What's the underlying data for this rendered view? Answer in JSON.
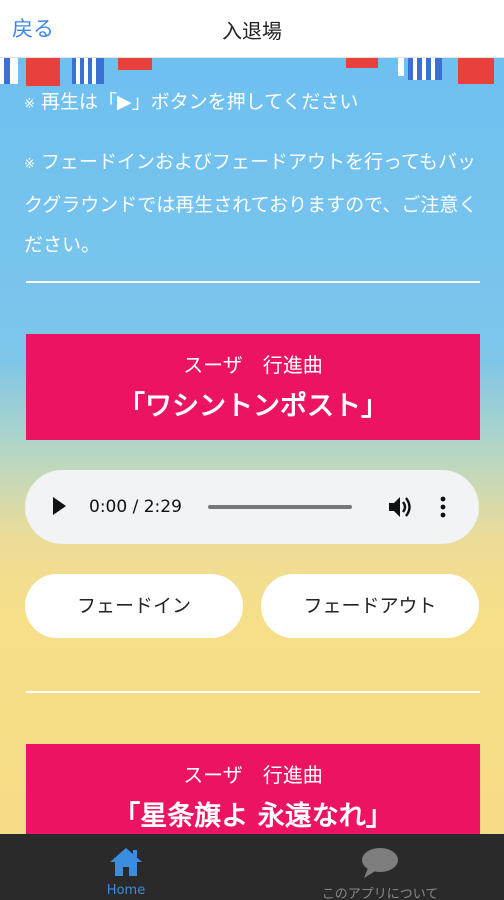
{
  "header": {
    "back_label": "戻る",
    "title": "入退場"
  },
  "notes": {
    "mark": "※",
    "note1": "再生は「▶」ボタンを押してください",
    "note2": "フェードインおよびフェードアウトを行ってもバックグラウンドでは再生されておりますので、ご注意ください。"
  },
  "tracks": [
    {
      "composer": "スーザ　行進曲",
      "title": "「ワシントンポスト」",
      "player": {
        "time": "0:00 / 2:29"
      },
      "fade_in_label": "フェードイン",
      "fade_out_label": "フェードアウト"
    },
    {
      "composer": "スーザ　行進曲",
      "title": "「星条旗よ 永遠なれ」"
    }
  ],
  "tabbar": {
    "items": [
      {
        "label": "Home",
        "icon": "home-icon",
        "active": true
      },
      {
        "label": "このアプリについて",
        "icon": "chat-bubble-icon",
        "active": false
      }
    ]
  },
  "colors": {
    "accent_pink": "#ec1462",
    "nav_link": "#3c86e6",
    "tab_active": "#3a8de0",
    "tab_inactive": "#888888"
  }
}
